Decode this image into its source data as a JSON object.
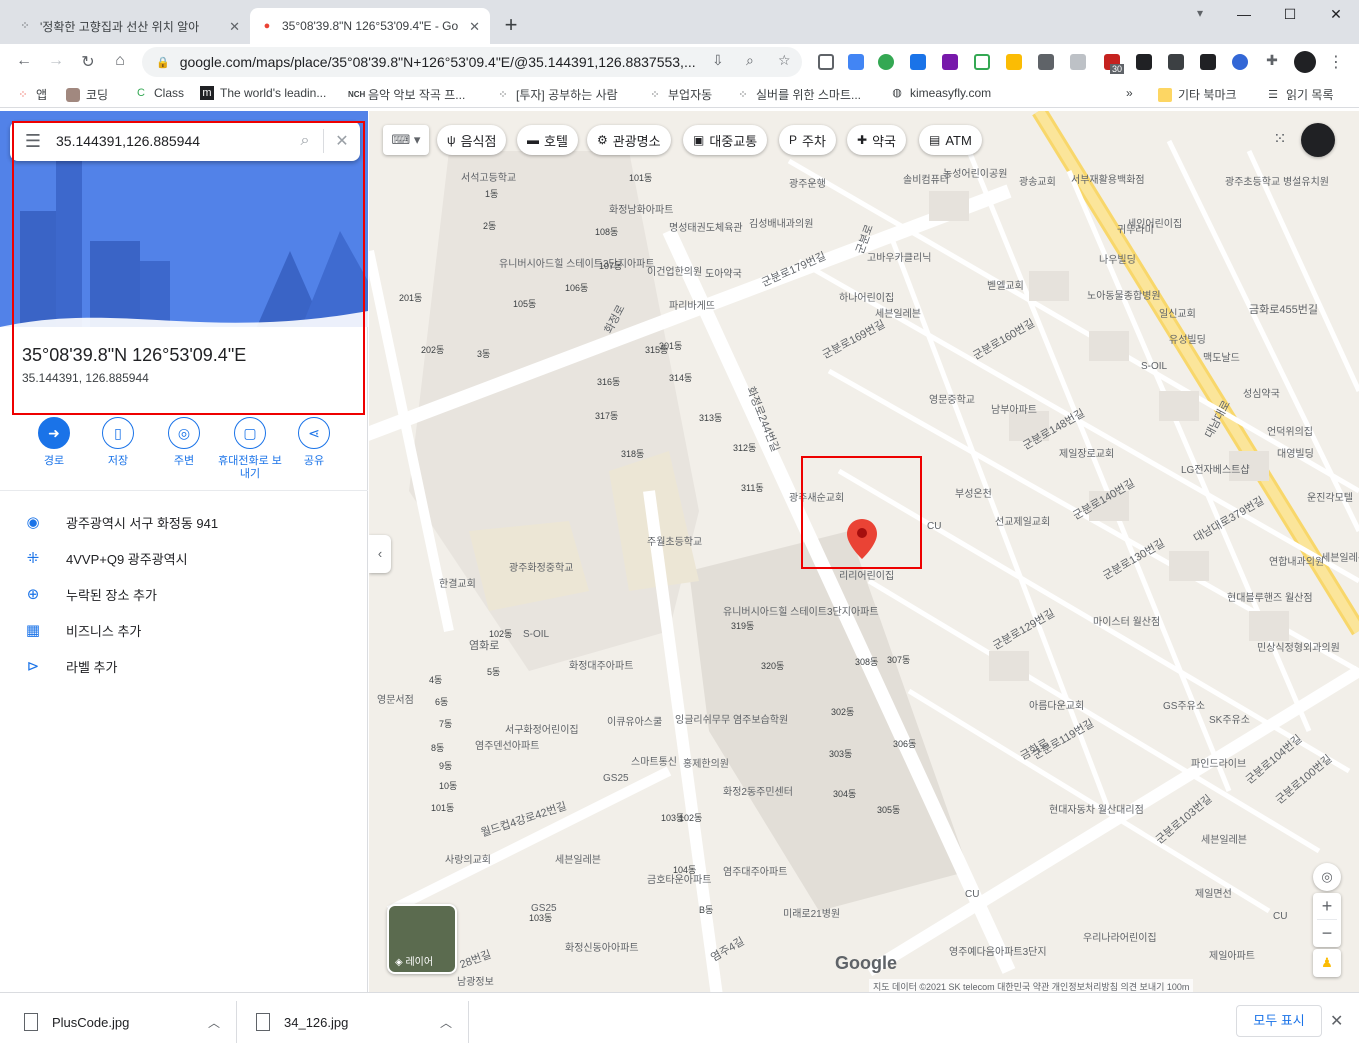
{
  "tabs": [
    {
      "title": "'정확한 고향집과 선산 위치 알아",
      "active": false
    },
    {
      "title": "35°08'39.8\"N 126°53'09.4\"E - Go",
      "active": true
    }
  ],
  "new_tab_glyph": "+",
  "window_controls": {
    "minimize": "—",
    "maximize": "☐",
    "close": "✕"
  },
  "url": "google.com/maps/place/35°08'39.8\"N+126°53'09.4\"E/@35.144391,126.8837553,...",
  "bookmarks": [
    {
      "label": "앱",
      "icon": "apps-icon"
    },
    {
      "label": "코딩",
      "icon": "dog-icon"
    },
    {
      "label": "Class",
      "icon": "class-icon"
    },
    {
      "label": "The world's leadin...",
      "icon": "m-logo-icon"
    },
    {
      "label": "음악 악보 작곡 프...",
      "icon": "nch-icon"
    },
    {
      "label": "[투자] 공부하는 사람",
      "icon": "dots-icon"
    },
    {
      "label": "부업자동",
      "icon": "dots-icon"
    },
    {
      "label": "실버를 위한 스마트...",
      "icon": "dots-icon"
    },
    {
      "label": "kimeasyfly.com",
      "icon": "globe-icon"
    }
  ],
  "bookmarks_more": "»",
  "bookmark_folder": "기타 북마크",
  "reading_list": "읽기 목록",
  "extension_badge": "30",
  "sidebar": {
    "search_value": "35.144391,126.885944",
    "title": "35°08'39.8\"N 126°53'09.4\"E",
    "coords": "35.144391, 126.885944",
    "actions": [
      {
        "label": "경로",
        "icon": "directions-icon"
      },
      {
        "label": "저장",
        "icon": "bookmark-icon"
      },
      {
        "label": "주변",
        "icon": "nearby-icon"
      },
      {
        "label": "휴대전화로 보내기",
        "icon": "send-to-phone-icon"
      },
      {
        "label": "공유",
        "icon": "share-icon"
      }
    ],
    "info": [
      {
        "text": "광주광역시 서구 화정동 941",
        "icon": "location-pin-icon"
      },
      {
        "text": "4VVP+Q9 광주광역시",
        "icon": "plus-code-icon"
      },
      {
        "text": "누락된 장소 추가",
        "icon": "add-place-icon"
      },
      {
        "text": "비즈니스 추가",
        "icon": "add-business-icon"
      },
      {
        "text": "라벨 추가",
        "icon": "label-icon"
      }
    ]
  },
  "map": {
    "chips": [
      {
        "label": "음식점",
        "icon": "ψ"
      },
      {
        "label": "호텔",
        "icon": "▬"
      },
      {
        "label": "관광명소",
        "icon": "⚙"
      },
      {
        "label": "대중교통",
        "icon": "▣"
      },
      {
        "label": "주차",
        "icon": "P"
      },
      {
        "label": "약국",
        "icon": "✚"
      },
      {
        "label": "ATM",
        "icon": "▤"
      }
    ],
    "labels": [
      {
        "text": "서석고등학교"
      },
      {
        "text": "광주운행"
      },
      {
        "text": "솔비컴퓨터"
      },
      {
        "text": "김성배내과의원"
      },
      {
        "text": "유니버시아드힐 스테이트3단지아파트"
      },
      {
        "text": "화정남화아파트"
      },
      {
        "text": "명성태권도체육관"
      },
      {
        "text": "이건업한의원"
      },
      {
        "text": "도아약국"
      },
      {
        "text": "파리바게뜨"
      },
      {
        "text": "고바우카클리닉"
      },
      {
        "text": "하나어린이집"
      },
      {
        "text": "세븐일레븐"
      },
      {
        "text": "농성어린이공원"
      },
      {
        "text": "광송교회"
      },
      {
        "text": "서부재활용백화점"
      },
      {
        "text": "광주초등학교 병설유치원"
      },
      {
        "text": "세인어린이집"
      },
      {
        "text": "귀뚜라미"
      },
      {
        "text": "나우빌딩"
      },
      {
        "text": "노아동물종합병원"
      },
      {
        "text": "벧엘교회"
      },
      {
        "text": "일신교회"
      },
      {
        "text": "유성빌딩"
      },
      {
        "text": "S-OIL"
      },
      {
        "text": "맥도날드"
      },
      {
        "text": "성심약국"
      },
      {
        "text": "언덕위의집"
      },
      {
        "text": "영문중학교"
      },
      {
        "text": "남부아파트"
      },
      {
        "text": "제일장로교회"
      },
      {
        "text": "대영빌딩"
      },
      {
        "text": "LG전자베스트샵"
      },
      {
        "text": "운진각모텔"
      },
      {
        "text": "광주새순교회"
      },
      {
        "text": "부성온천"
      },
      {
        "text": "선교제일교회"
      },
      {
        "text": "리리어린이집"
      },
      {
        "text": "주월초등학교"
      },
      {
        "text": "광주화정중학교"
      },
      {
        "text": "한결교회"
      },
      {
        "text": "유니버시아드힐 스테이트3단지아파트"
      },
      {
        "text": "연합내과의원"
      },
      {
        "text": "세븐일레븐"
      },
      {
        "text": "현대블루핸즈 월산점"
      },
      {
        "text": "마이스터 월산점"
      },
      {
        "text": "S-OIL"
      },
      {
        "text": "화정대주아파트"
      },
      {
        "text": "민상식정형외과의원"
      },
      {
        "text": "영문서점"
      },
      {
        "text": "서구화정어린이집"
      },
      {
        "text": "이큐유아스쿨"
      },
      {
        "text": "잉글리쉬무무 염주보습학원"
      },
      {
        "text": "염주덴선아파트"
      },
      {
        "text": "스마트통신"
      },
      {
        "text": "홍제한의원"
      },
      {
        "text": "아름다운교회"
      },
      {
        "text": "GS주유소"
      },
      {
        "text": "SK주유소"
      },
      {
        "text": "파인드라이브"
      },
      {
        "text": "GS25"
      },
      {
        "text": "화정2동주민센터"
      },
      {
        "text": "현대자동차 월산대리점"
      },
      {
        "text": "사랑의교회"
      },
      {
        "text": "세븐일레븐"
      },
      {
        "text": "염주대주아파트"
      },
      {
        "text": "금호타운아파트"
      },
      {
        "text": "제일면선"
      },
      {
        "text": "세븐일레븐"
      },
      {
        "text": "GS25"
      },
      {
        "text": "미래로21병원"
      },
      {
        "text": "화정신동아아파트"
      },
      {
        "text": "영주예다음아파트3단지"
      },
      {
        "text": "우리나라어린이집"
      },
      {
        "text": "제일아파트"
      },
      {
        "text": "남광정보"
      },
      {
        "text": "CU"
      },
      {
        "text": "CU"
      },
      {
        "text": "CU"
      }
    ],
    "roads": [
      {
        "text": "화정로"
      },
      {
        "text": "화정로244번길"
      },
      {
        "text": "군분로"
      },
      {
        "text": "군분로179번길"
      },
      {
        "text": "군분로169번길"
      },
      {
        "text": "군분로160번길"
      },
      {
        "text": "군분로148번길"
      },
      {
        "text": "군분로140번길"
      },
      {
        "text": "군분로130번길"
      },
      {
        "text": "군분로129번길"
      },
      {
        "text": "군분로119번길"
      },
      {
        "text": "군분로104번길"
      },
      {
        "text": "군분로100번길"
      },
      {
        "text": "군분로103번길"
      },
      {
        "text": "금화로"
      },
      {
        "text": "금화로455번길"
      },
      {
        "text": "대남대로"
      },
      {
        "text": "월드컵4강로42번길"
      },
      {
        "text": "염화로"
      },
      {
        "text": "대남대로379번길"
      },
      {
        "text": "염주4길"
      },
      {
        "text": "28번길"
      }
    ],
    "blocks": [
      "101동",
      "102동",
      "103동",
      "105동",
      "106동",
      "107동",
      "108동",
      "201동",
      "202동",
      "301동",
      "302동",
      "303동",
      "304동",
      "305동",
      "306동",
      "307동",
      "308동",
      "311동",
      "312동",
      "313동",
      "314동",
      "315동",
      "316동",
      "317동",
      "318동",
      "319동",
      "320동",
      "1동",
      "2동",
      "3동",
      "4동",
      "5동",
      "6동",
      "7동",
      "8동",
      "9동",
      "10동",
      "101동",
      "102동",
      "103동",
      "104동",
      "B동"
    ],
    "attribution": "지도 데이터 ©2021 SK telecom   대한민국   약관   개인정보처리방침   의견 보내기   100m",
    "google_logo": "Google",
    "layer_label": "레이어",
    "zoom_in": "+",
    "zoom_out": "−",
    "collapse": "‹"
  },
  "downloads": [
    {
      "name": "PlusCode.jpg"
    },
    {
      "name": "34_126.jpg"
    }
  ],
  "show_all": "모두 표시",
  "close_downloads": "✕"
}
